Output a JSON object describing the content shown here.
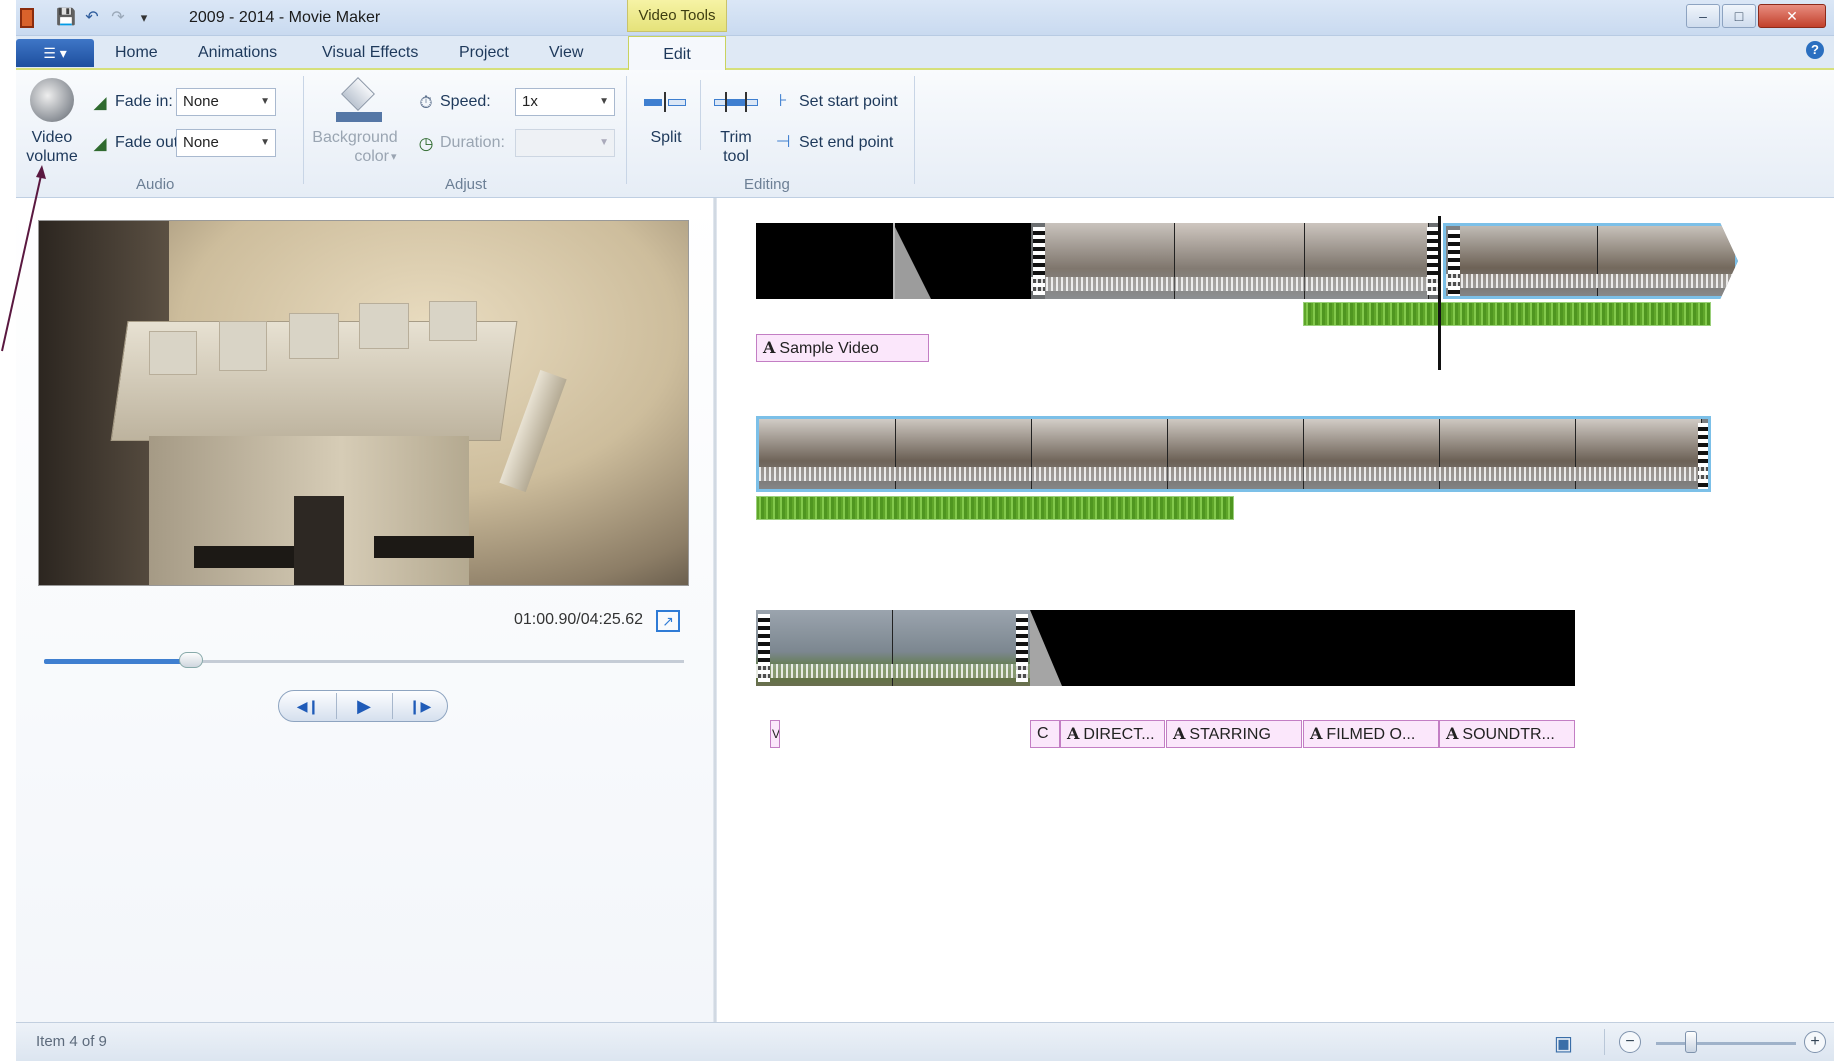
{
  "window": {
    "title": "2009 - 2014 - Movie Maker",
    "contextual_tab": "Video Tools",
    "controls": {
      "minimize": "–",
      "maximize": "□",
      "close": "✕"
    }
  },
  "quick_access": {
    "save_icon": "💾",
    "undo_icon": "↶",
    "redo_icon": "↷",
    "customize_icon": "▾"
  },
  "ribbon": {
    "file_button_label": "☰ ▾",
    "tabs": [
      "Home",
      "Animations",
      "Visual Effects",
      "Project",
      "View",
      "Edit"
    ],
    "active_tab": "Edit",
    "audio": {
      "video_volume_label": [
        "Video",
        "volume"
      ],
      "fade_in_label": "Fade in:",
      "fade_in_value": "None",
      "fade_out_label": "Fade out:",
      "fade_out_value": "None",
      "group_label": "Audio"
    },
    "adjust": {
      "background_color_label": [
        "Background",
        "color"
      ],
      "background_color_caret": "▾",
      "speed_label": "Speed:",
      "speed_value": "1x",
      "duration_label": "Duration:",
      "duration_value": "",
      "group_label": "Adjust"
    },
    "editing": {
      "split_label": "Split",
      "trim_label": [
        "Trim",
        "tool"
      ],
      "set_start_label": "Set start point",
      "set_end_label": "Set end point",
      "group_label": "Editing"
    },
    "help_icon": "?"
  },
  "preview": {
    "timecode": "01:00.90/04:25.62",
    "fullscreen_icon": "↗",
    "seek_progress": 0.23,
    "prev_frame_icon": "◀❙",
    "play_icon": "▶",
    "next_frame_icon": "❙▶"
  },
  "storyboard": {
    "captions_row1": [
      "Sample Video"
    ],
    "captions_row3": [
      "V",
      "C",
      "DIRECT...",
      "STARRING",
      "FILMED O...",
      "SOUNDTR..."
    ],
    "caption_icon": "A"
  },
  "status": {
    "item_text": "Item 4 of 9",
    "zoom_level": 0.25,
    "zoom_out_icon": "−",
    "zoom_in_icon": "+",
    "thumbnail_icon": "▣"
  },
  "colors": {
    "accent_blue": "#2b6fc0",
    "contextual_yellow": "#e5e27a",
    "caption_pink": "#fbe7fb",
    "audio_green": "#5fa62a",
    "selection_border": "#7cc0e8"
  }
}
